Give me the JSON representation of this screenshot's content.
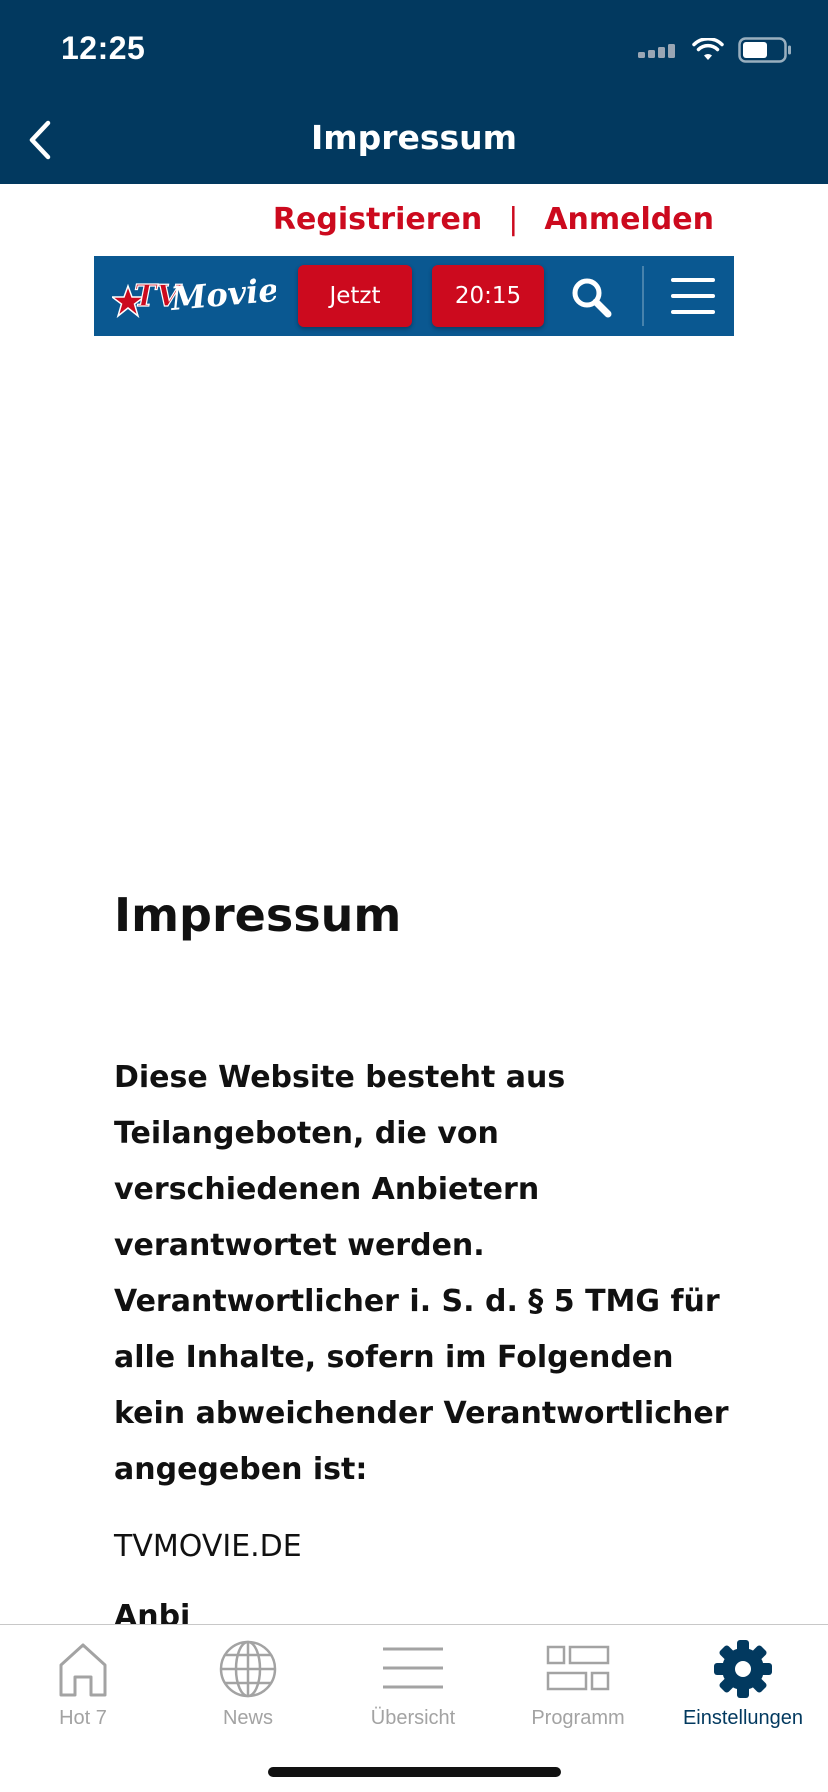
{
  "status_bar": {
    "time": "12:25"
  },
  "nav": {
    "title": "Impressum"
  },
  "auth": {
    "register": "Registrieren",
    "separator": "|",
    "login": "Anmelden"
  },
  "site_bar": {
    "logo": "TV Movie",
    "now_label": "Jetzt",
    "prime_label": "20:15"
  },
  "page": {
    "heading": "Impressum",
    "intro": "Diese Website besteht aus Teilangeboten, die von verschiedenen Anbietern verantwortet werden. Verantwortlicher i. S. d. § 5 TMG für alle Inhalte, sofern im Folgenden kein abweichender Verantwortlicher angegeben ist:",
    "site_name": "TVMOVIE.DE",
    "next_heading_partial": "Anbi"
  },
  "tabs": [
    {
      "label": "Hot 7",
      "icon": "home-icon"
    },
    {
      "label": "News",
      "icon": "globe-icon"
    },
    {
      "label": "Übersicht",
      "icon": "list-icon"
    },
    {
      "label": "Programm",
      "icon": "grid-icon"
    },
    {
      "label": "Einstellungen",
      "icon": "gear-icon",
      "active": true
    }
  ],
  "colors": {
    "header": "#02395f",
    "brand_red": "#cc0a1e",
    "site_bar": "#0a5891",
    "tab_inactive": "#a3a3a3"
  }
}
